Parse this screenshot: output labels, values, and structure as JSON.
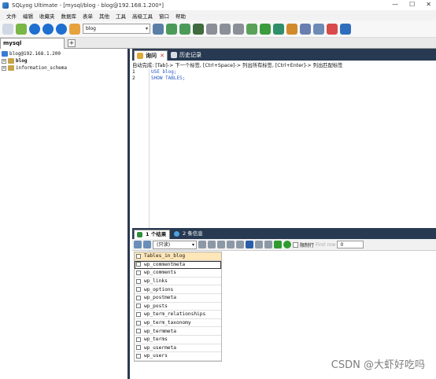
{
  "window": {
    "title": "SQLyog Ultimate - [mysql/blog - blog@192.168.1.200*]",
    "min": "—",
    "max": "☐",
    "close": "✕"
  },
  "menu": [
    "文件",
    "编辑",
    "收藏夹",
    "数据库",
    "表单",
    "其他",
    "工具",
    "高级工具",
    "窗口",
    "帮助"
  ],
  "toolbar": {
    "db_select_value": "blog",
    "db_select_arrow": "▾"
  },
  "connection_tab": {
    "label": "mysql",
    "add": "+"
  },
  "tree": {
    "root": "blog@192.168.1.200",
    "databases": [
      "blog",
      "information_schema"
    ],
    "expander": "+"
  },
  "query_tabs": {
    "query": "询问",
    "history": "历史记录",
    "close": "✕"
  },
  "autocomplete_hint": "自动完成: [Tab]-> 下一个标签, [Ctrl+Space]-> 列出所有标签, [Ctrl+Enter]-> 列出匹配标签",
  "editor": {
    "line_numbers": [
      "1",
      "2"
    ],
    "lines": [
      "USE blog;",
      "SHOW TABLES;"
    ]
  },
  "result_tabs": {
    "results": "1 个结果",
    "messages": "2 条信息"
  },
  "result_toolbar": {
    "readonly_option": "(只读)",
    "dd_arrow": "▾",
    "limit_label": "限制行",
    "first_row_label": "First row",
    "first_row_value": "0"
  },
  "result_grid": {
    "header": "Tables_in_blog",
    "rows": [
      "wp_commentmeta",
      "wp_comments",
      "wp_links",
      "wp_options",
      "wp_postmeta",
      "wp_posts",
      "wp_term_relationships",
      "wp_term_taxonomy",
      "wp_termmeta",
      "wp_terms",
      "wp_usermeta",
      "wp_users"
    ]
  },
  "watermark": "CSDN @大虾好吃吗"
}
